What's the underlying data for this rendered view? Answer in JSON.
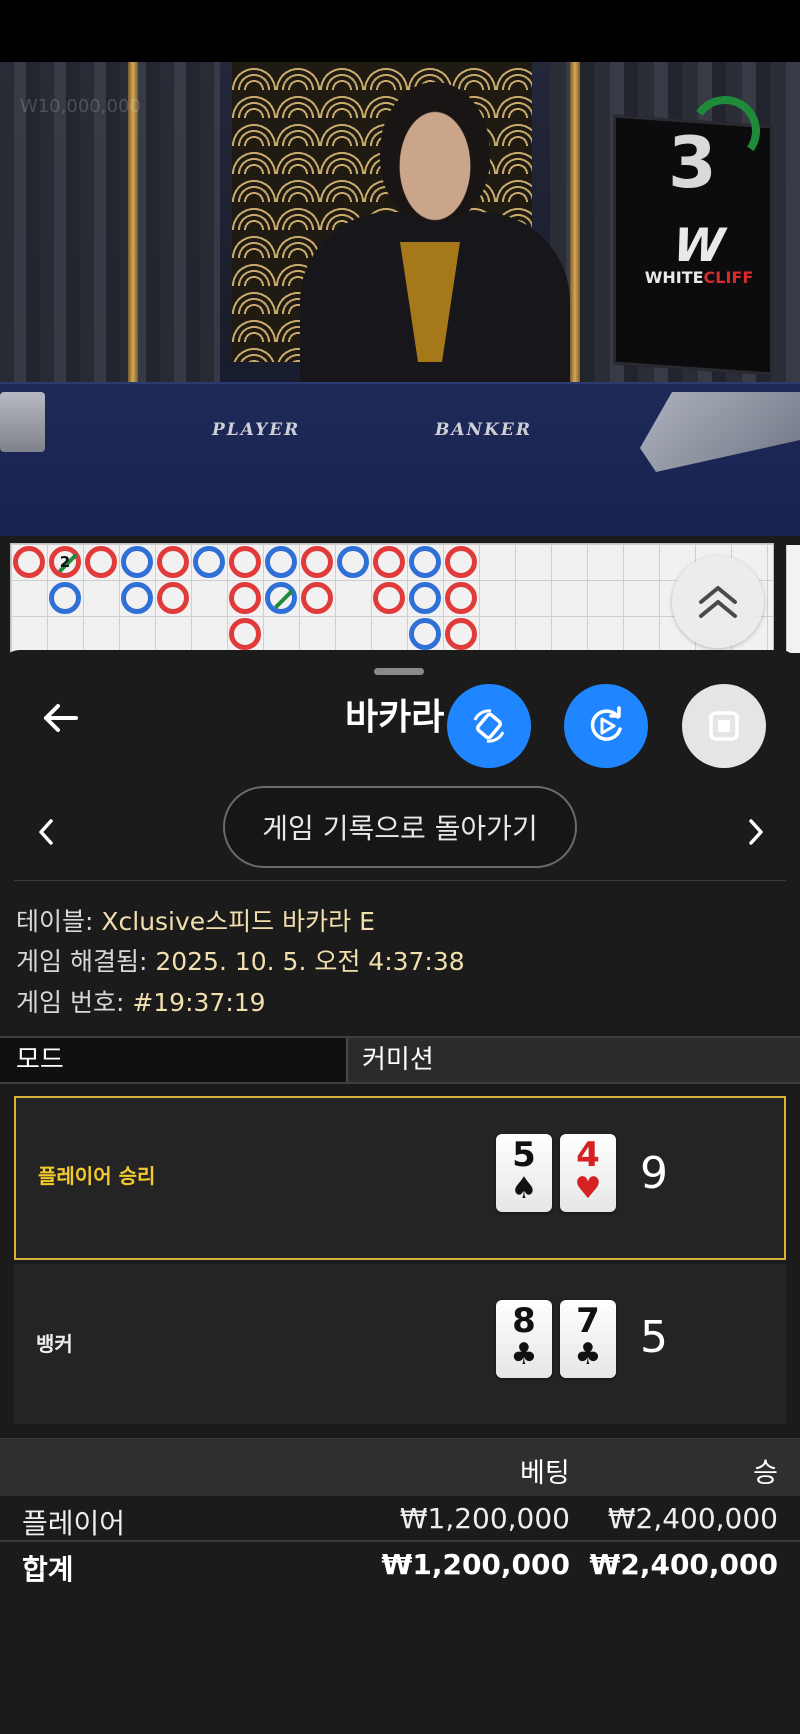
{
  "video": {
    "watermark": "W10,000,000",
    "countdown": "3",
    "brand": {
      "mark": "W",
      "text_white": "WHITE",
      "text_red": "CLIFF"
    },
    "table_labels": {
      "player": "PLAYER",
      "banker": "BANKER"
    }
  },
  "roadmap": {
    "cells": [
      {
        "col": 0,
        "row": 0,
        "result": "banker"
      },
      {
        "col": 1,
        "row": 0,
        "result": "banker",
        "tie": true,
        "number": "2"
      },
      {
        "col": 1,
        "row": 1,
        "result": "player"
      },
      {
        "col": 2,
        "row": 0,
        "result": "banker"
      },
      {
        "col": 3,
        "row": 0,
        "result": "player"
      },
      {
        "col": 3,
        "row": 1,
        "result": "player"
      },
      {
        "col": 4,
        "row": 0,
        "result": "banker"
      },
      {
        "col": 4,
        "row": 1,
        "result": "banker"
      },
      {
        "col": 5,
        "row": 0,
        "result": "player"
      },
      {
        "col": 6,
        "row": 0,
        "result": "banker"
      },
      {
        "col": 6,
        "row": 1,
        "result": "banker"
      },
      {
        "col": 6,
        "row": 2,
        "result": "banker"
      },
      {
        "col": 7,
        "row": 0,
        "result": "player"
      },
      {
        "col": 7,
        "row": 1,
        "result": "player",
        "tie": true
      },
      {
        "col": 8,
        "row": 0,
        "result": "banker"
      },
      {
        "col": 8,
        "row": 1,
        "result": "banker"
      },
      {
        "col": 9,
        "row": 0,
        "result": "player"
      },
      {
        "col": 10,
        "row": 0,
        "result": "banker"
      },
      {
        "col": 10,
        "row": 1,
        "result": "banker"
      },
      {
        "col": 11,
        "row": 0,
        "result": "player"
      },
      {
        "col": 11,
        "row": 1,
        "result": "player"
      },
      {
        "col": 11,
        "row": 2,
        "result": "player"
      },
      {
        "col": 12,
        "row": 0,
        "result": "banker"
      },
      {
        "col": 12,
        "row": 1,
        "result": "banker"
      },
      {
        "col": 12,
        "row": 2,
        "result": "banker"
      }
    ],
    "colors": {
      "banker": "#e03a3a",
      "player": "#2f6fd6",
      "tie": "#1e8a3a"
    }
  },
  "sheet": {
    "title": "바카라",
    "history_button": "게임 기록으로 돌아가기",
    "icons": {
      "back": "arrow-left-icon",
      "fab1": "rotate-icon",
      "fab2": "replay-icon",
      "fab3": "stop-icon",
      "prev": "chevron-left-icon",
      "next": "chevron-right-icon",
      "scroll": "double-chevron-up-icon"
    },
    "info": {
      "table_label": "테이블: ",
      "table_value": "Xclusive스피드 바카라 E",
      "resolved_label": "게임 해결됨: ",
      "resolved_value": "2025. 10. 5. 오전 4:37:38",
      "number_label": "게임 번호: ",
      "number_value": "#19:37:19"
    },
    "mode": {
      "label": "모드",
      "value": "커미션"
    },
    "results": [
      {
        "label": "플레이어 승리",
        "winner": true,
        "cards": [
          {
            "rank": "5",
            "suit": "♠",
            "color": "black"
          },
          {
            "rank": "4",
            "suit": "♥",
            "color": "red"
          }
        ],
        "score": "9"
      },
      {
        "label": "뱅커",
        "winner": false,
        "cards": [
          {
            "rank": "8",
            "suit": "♣",
            "color": "black"
          },
          {
            "rank": "7",
            "suit": "♣",
            "color": "black"
          }
        ],
        "score": "5"
      }
    ],
    "bets": {
      "headers": {
        "bet": "베팅",
        "win": "승"
      },
      "rows": [
        {
          "name": "플레이어",
          "bet": "₩1,200,000",
          "win": "₩2,400,000"
        }
      ],
      "total": {
        "name": "합계",
        "bet": "₩1,200,000",
        "win": "₩2,400,000"
      }
    },
    "colors": {
      "accent_blue": "#1f86ff",
      "win_gold": "#f4c92d",
      "value_cream": "#f2dfae"
    }
  }
}
